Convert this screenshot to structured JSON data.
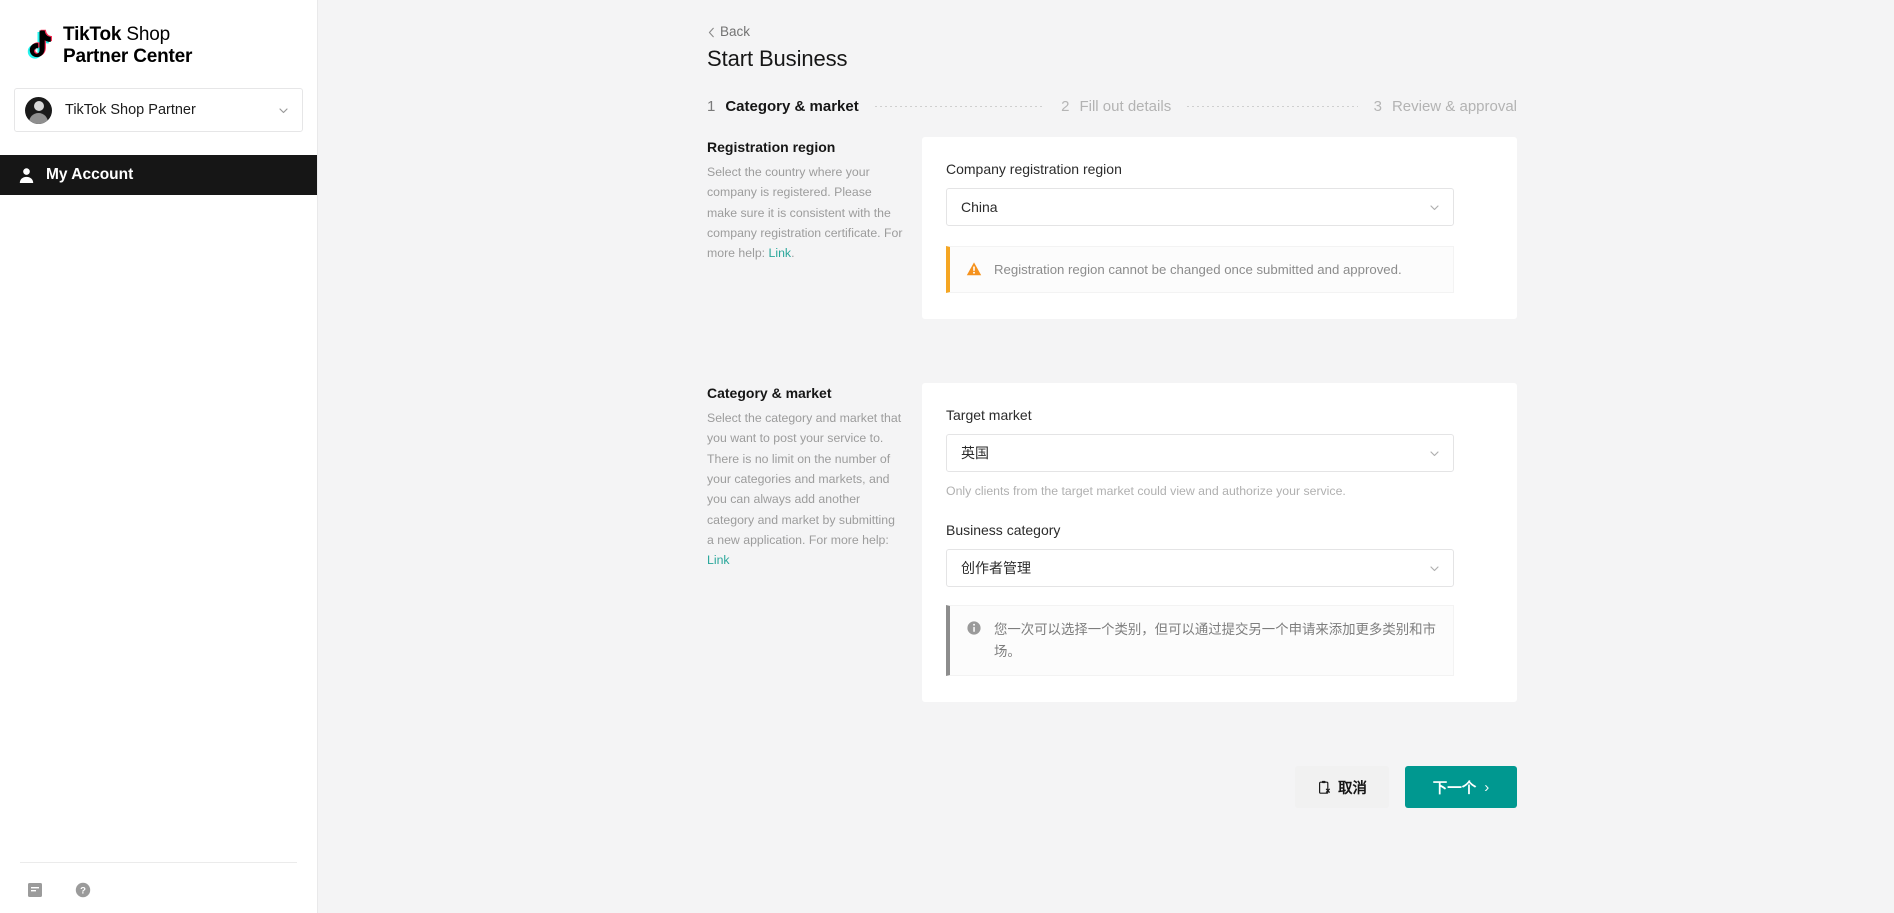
{
  "sidebar": {
    "logo": {
      "line1_bold": "TikTok",
      "line1_light": " Shop",
      "line2": "Partner Center"
    },
    "account": {
      "name": "TikTok Shop Partner"
    },
    "nav": [
      {
        "label": "My Account",
        "icon": "person-icon",
        "active": true
      }
    ],
    "footer_icons": [
      "book-icon",
      "help-circle-icon"
    ]
  },
  "header": {
    "back_label": "Back",
    "title": "Start Business"
  },
  "stepper": [
    {
      "num": "1",
      "label": "Category & market",
      "active": true
    },
    {
      "num": "2",
      "label": "Fill out details",
      "active": false
    },
    {
      "num": "3",
      "label": "Review & approval",
      "active": false
    }
  ],
  "sections": [
    {
      "heading": "Registration region",
      "description": "Select the country where your company is registered. Please make sure it is consistent with the company registration certificate. For more help: ",
      "link_label": "Link",
      "description_tail": ".",
      "field_label": "Company registration region",
      "field_value": "China",
      "alert": {
        "type": "warning",
        "icon": "warning-triangle-icon",
        "text": "Registration region cannot be changed once submitted and approved.",
        "accent": "#f5a623"
      }
    },
    {
      "heading": "Category & market",
      "description": "Select the category and market that you want to post your service to. There is no limit on the number of your categories and markets, and you can always add another category and market by submitting a new application. For more help: ",
      "link_label": "Link",
      "description_tail": "",
      "target_market_label": "Target market",
      "target_market_value": "英国",
      "target_market_helper": "Only clients from the target market could view and authorize your service.",
      "business_category_label": "Business category",
      "business_category_value": "创作者管理",
      "alert": {
        "type": "info",
        "icon": "info-circle-icon",
        "text": "您一次可以选择一个类别，但可以通过提交另一个申请来添加更多类别和市场。",
        "accent": "#8d8d8d"
      }
    }
  ],
  "actions": {
    "cancel_label": "取消",
    "cancel_icon": "clipboard-x-icon",
    "next_label": "下一个",
    "next_arrow": "›",
    "next_color": "#009890"
  },
  "theme": {
    "accent_teal": "#2aa79b",
    "page_bg": "#f4f4f5",
    "nav_active_bg": "#161616"
  }
}
